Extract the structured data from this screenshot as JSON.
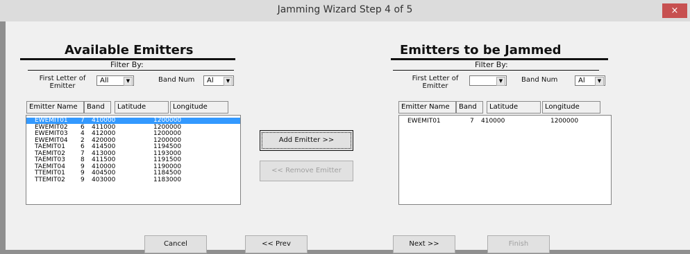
{
  "window": {
    "title": "Jamming Wizard Step 4 of 5",
    "close_glyph": "×"
  },
  "left_panel": {
    "title": "Available Emitters",
    "filter_by": "Filter By:",
    "first_letter_label": "First Letter of Emitter",
    "first_letter_value": "All",
    "band_label": "Band Num",
    "band_value": "Al",
    "columns": [
      "Emitter Name",
      "Band",
      "Latitude",
      "Longitude"
    ],
    "rows": [
      [
        "EWEMIT01",
        "7",
        "410000",
        "1200000"
      ],
      [
        "EWEMIT02",
        "6",
        "411000",
        "1200000"
      ],
      [
        "EWEMIT03",
        "4",
        "412000",
        "1200000"
      ],
      [
        "EWEMIT04",
        "2",
        "420000",
        "1200000"
      ],
      [
        "TAEMIT01",
        "6",
        "414500",
        "1194500"
      ],
      [
        "TAEMIT02",
        "7",
        "413000",
        "1193000"
      ],
      [
        "TAEMIT03",
        "8",
        "411500",
        "1191500"
      ],
      [
        "TAEMIT04",
        "9",
        "410000",
        "1190000"
      ],
      [
        "TTEMIT01",
        "9",
        "404500",
        "1184500"
      ],
      [
        "TTEMIT02",
        "9",
        "403000",
        "1183000"
      ]
    ],
    "selected_row": 0
  },
  "middle": {
    "add_label": "Add Emitter >>",
    "remove_label": "<< Remove Emitter"
  },
  "right_panel": {
    "title": "Emitters to be Jammed",
    "filter_by": "Filter By:",
    "first_letter_label": "First Letter of Emitter",
    "first_letter_value": "",
    "band_label": "Band Num",
    "band_value": "Al",
    "columns": [
      "Emitter Name",
      "Band",
      "Latitude",
      "Longitude"
    ],
    "rows": [
      [
        "EWEMIT01",
        "7",
        "410000",
        "1200000"
      ]
    ]
  },
  "footer": {
    "cancel": "Cancel",
    "prev": "<< Prev",
    "next": "Next >>",
    "finish": "Finish"
  },
  "icons": {
    "dropdown": "▼"
  }
}
